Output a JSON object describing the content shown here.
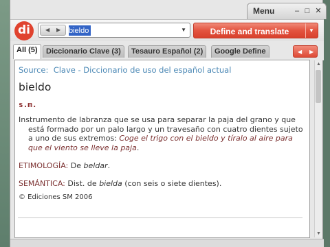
{
  "window": {
    "menu_label": "Menu",
    "minimize_glyph": "–",
    "maximize_glyph": "□",
    "close_glyph": "✕"
  },
  "toolbar": {
    "logo_text": "di",
    "search_value": "bieldo",
    "define_label": "Define and translate",
    "back_glyph": "◀",
    "forward_glyph": "▶",
    "dropdown_glyph": "▼"
  },
  "tabs": [
    {
      "label": "All (5)",
      "active": true
    },
    {
      "label": "Diccionario Clave (3)",
      "active": false
    },
    {
      "label": "Tesauro Español (2)",
      "active": false
    },
    {
      "label": "Google Define",
      "active": false
    }
  ],
  "entry": {
    "source_prefix": "Source:",
    "source_name": "Clave - Diccionario de uso del español actual",
    "headword": "bieldo",
    "pos": "s.m.",
    "definition": "Instrumento de labranza que se usa para separar la paja del grano y que está formado por un palo largo y un travesaño con cuatro dientes sujeto a uno de sus extremos:",
    "example": "Coge el trigo con el bieldo y tíralo al aire para que el viento se lleve la paja",
    "etym_label": "ETIMOLOGÍA:",
    "etym_text": "De",
    "etym_word": "beldar",
    "sem_label": "SEMÁNTICA:",
    "sem_text": "Dist. de",
    "sem_word": "bielda",
    "sem_rest": "(con seis o siete dientes).",
    "copyright": "© Ediciones SM 2006"
  },
  "colors": {
    "accent": "#e0432f",
    "source_link": "#4b88b5",
    "label_red": "#7a2f2f"
  }
}
